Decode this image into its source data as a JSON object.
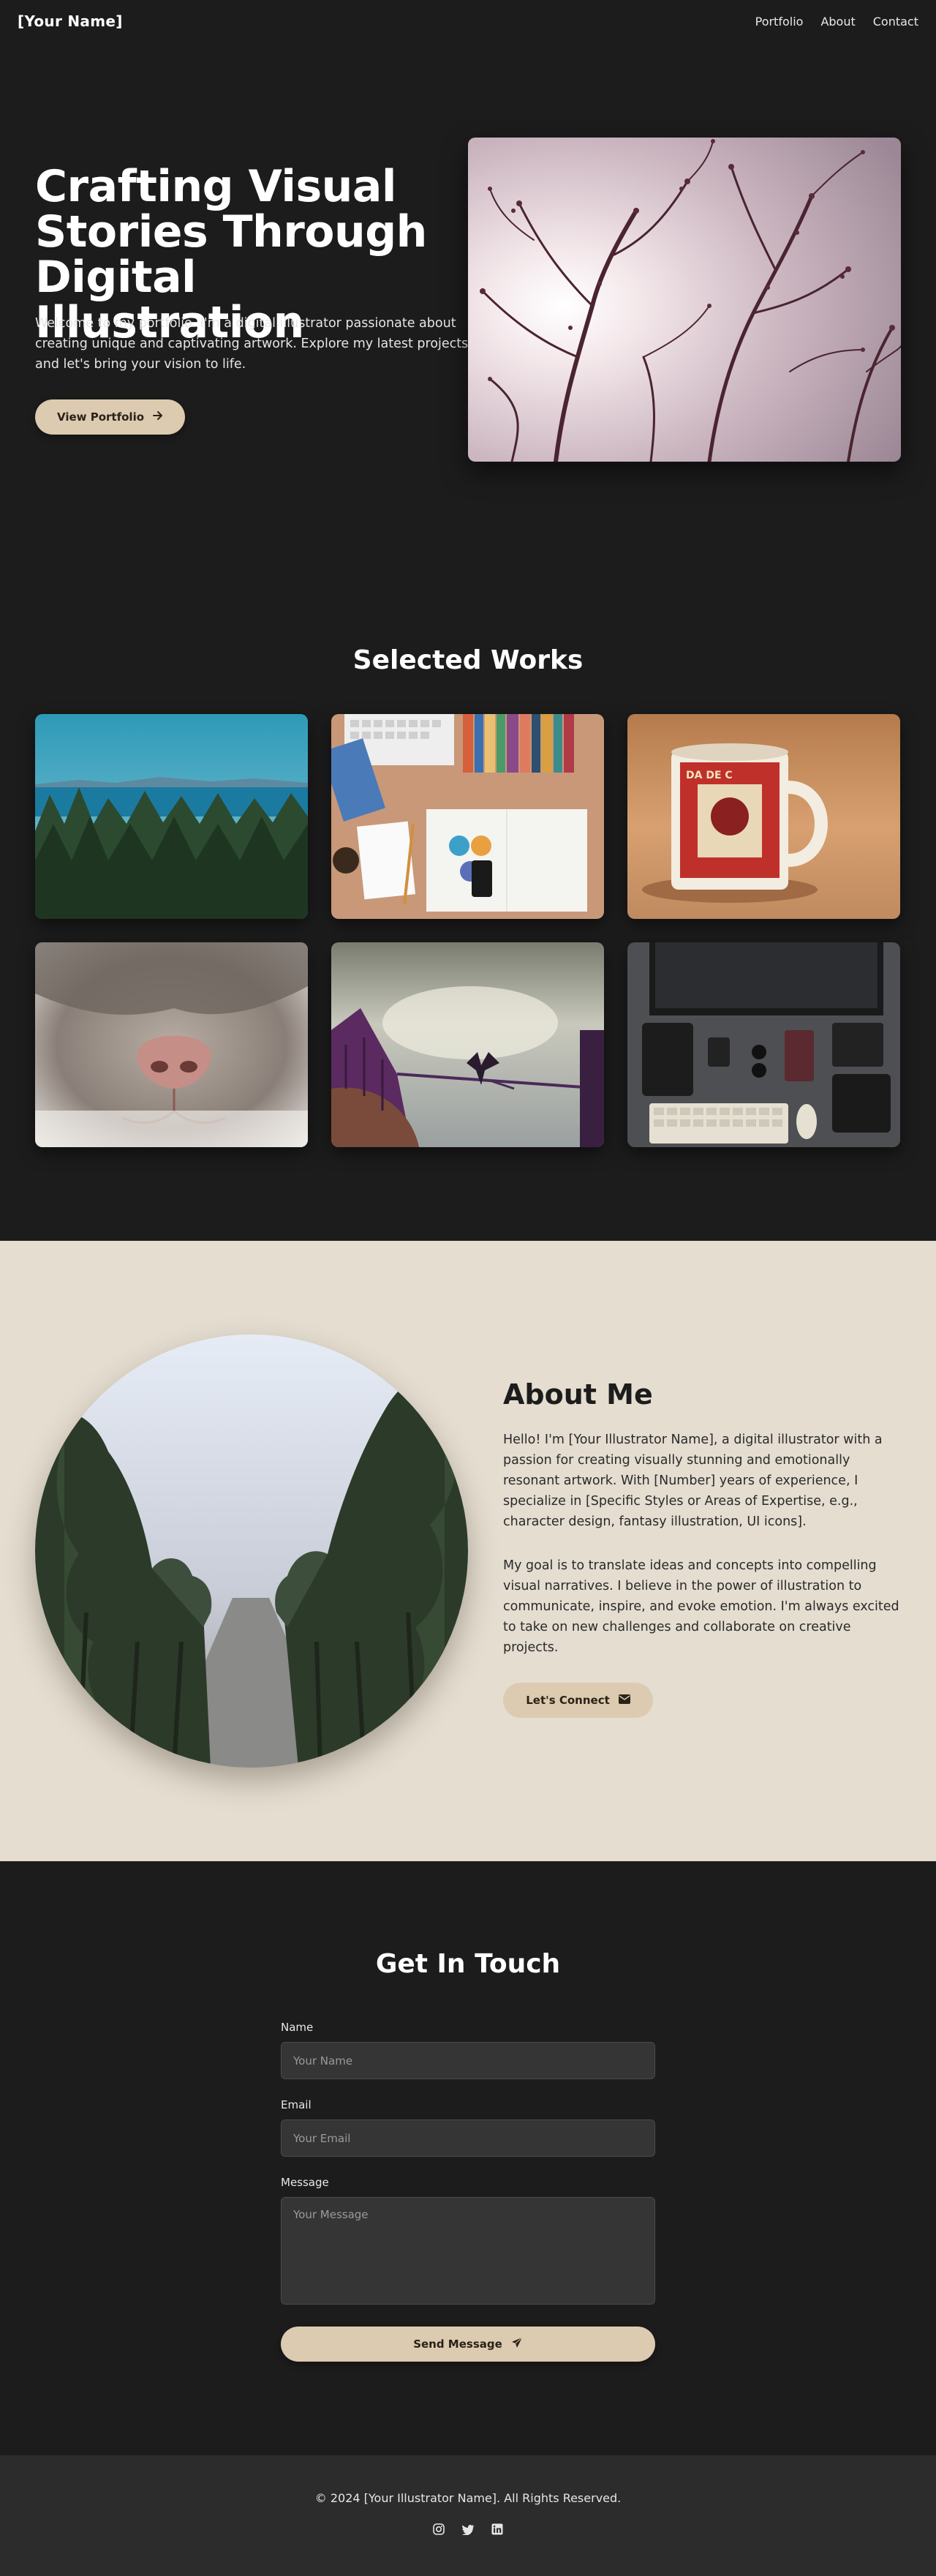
{
  "nav": {
    "brand": "[Your Name]",
    "links": [
      "Portfolio",
      "About",
      "Contact"
    ]
  },
  "hero": {
    "title": "Crafting Visual Stories Through Digital Illustration",
    "text": "Welcome to my portfolio. I'm a digital illustrator passionate about creating unique and captivating artwork. Explore my latest projects and let's bring your vision to life.",
    "button": "View Portfolio",
    "button_icon": "arrow-right-icon"
  },
  "works": {
    "title": "Selected Works",
    "items": [
      "coastal-forest",
      "desk-flatlay",
      "vintage-mug",
      "cat-nose",
      "boat-bird",
      "workspace-devices"
    ]
  },
  "about": {
    "title": "About Me",
    "paragraph1": "Hello! I'm [Your Illustrator Name], a digital illustrator with a passion for creating visually stunning and emotionally resonant artwork. With [Number] years of experience, I specialize in [Specific Styles or Areas of Expertise, e.g., character design, fantasy illustration, UI icons].",
    "paragraph2": "My goal is to translate ideas and concepts into compelling visual narratives. I believe in the power of illustration to communicate, inspire, and evoke emotion. I'm always excited to take on new challenges and collaborate on creative projects.",
    "button": "Let's Connect",
    "button_icon": "envelope-icon"
  },
  "contact": {
    "title": "Get In Touch",
    "name_label": "Name",
    "name_placeholder": "Your Name",
    "email_label": "Email",
    "email_placeholder": "Your Email",
    "message_label": "Message",
    "message_placeholder": "Your Message",
    "submit": "Send Message",
    "submit_icon": "paper-plane-icon"
  },
  "footer": {
    "copyright": "© 2024 [Your Illustrator Name]. All Rights Reserved.",
    "socials": [
      "instagram-icon",
      "twitter-icon",
      "linkedin-icon"
    ]
  },
  "colors": {
    "background": "#1c1c1c",
    "accent": "#dccbb0",
    "about_background": "#e4ddd0",
    "footer": "#2c2c2c"
  }
}
